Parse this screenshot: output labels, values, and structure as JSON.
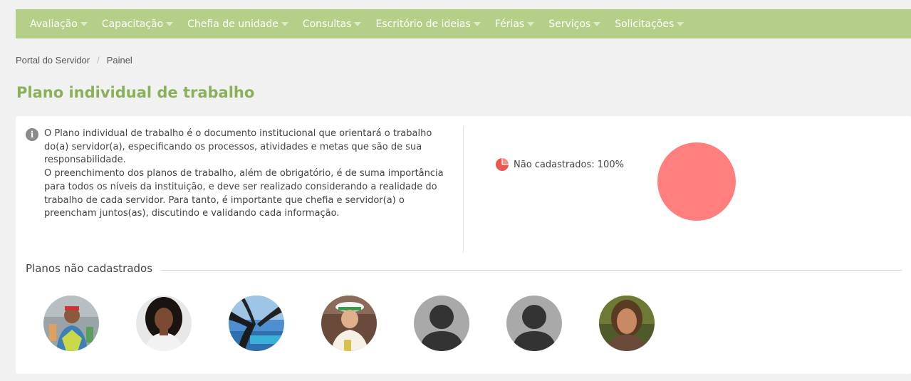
{
  "nav": {
    "items": [
      "Avaliação",
      "Capacitação",
      "Chefia de unidade",
      "Consultas",
      "Escritório de ideias",
      "Férias",
      "Serviços",
      "Solicitações"
    ]
  },
  "breadcrumb": {
    "first": "Portal do Servidor",
    "separator": "/",
    "second": "Painel"
  },
  "page": {
    "title": "Plano individual de trabalho"
  },
  "info": {
    "icon": "info-icon",
    "paragraph1": "O Plano individual de trabalho é o documento institucional que orientará o trabalho do(a) servidor(a), especificando os processos, atividades e metas que são de sua responsabilidade.",
    "paragraph2": "O preenchimento dos planos de trabalho, além de obrigatório, é de suma importância para todos os níveis da instituição, e deve ser realizado considerando a realidade do trabalho de cada servidor. Para tanto, é importante que chefia e servidor(a) o preencham juntos(as), discutindo e validando cada informação."
  },
  "chart_data": {
    "type": "pie",
    "slices": [
      {
        "label": "Não cadastrados",
        "value": 100,
        "color": "#ff7f7f"
      }
    ],
    "legend_text": "Não cadastrados: 100%"
  },
  "section": {
    "title": "Planos não cadastrados"
  },
  "avatars": [
    {
      "kind": "photo"
    },
    {
      "kind": "photo"
    },
    {
      "kind": "photo"
    },
    {
      "kind": "photo"
    },
    {
      "kind": "placeholder"
    },
    {
      "kind": "placeholder"
    },
    {
      "kind": "photo"
    }
  ],
  "colors": {
    "nav_bg": "#b4cf87",
    "title": "#8cb05a",
    "pie": "#ff7f7f"
  }
}
